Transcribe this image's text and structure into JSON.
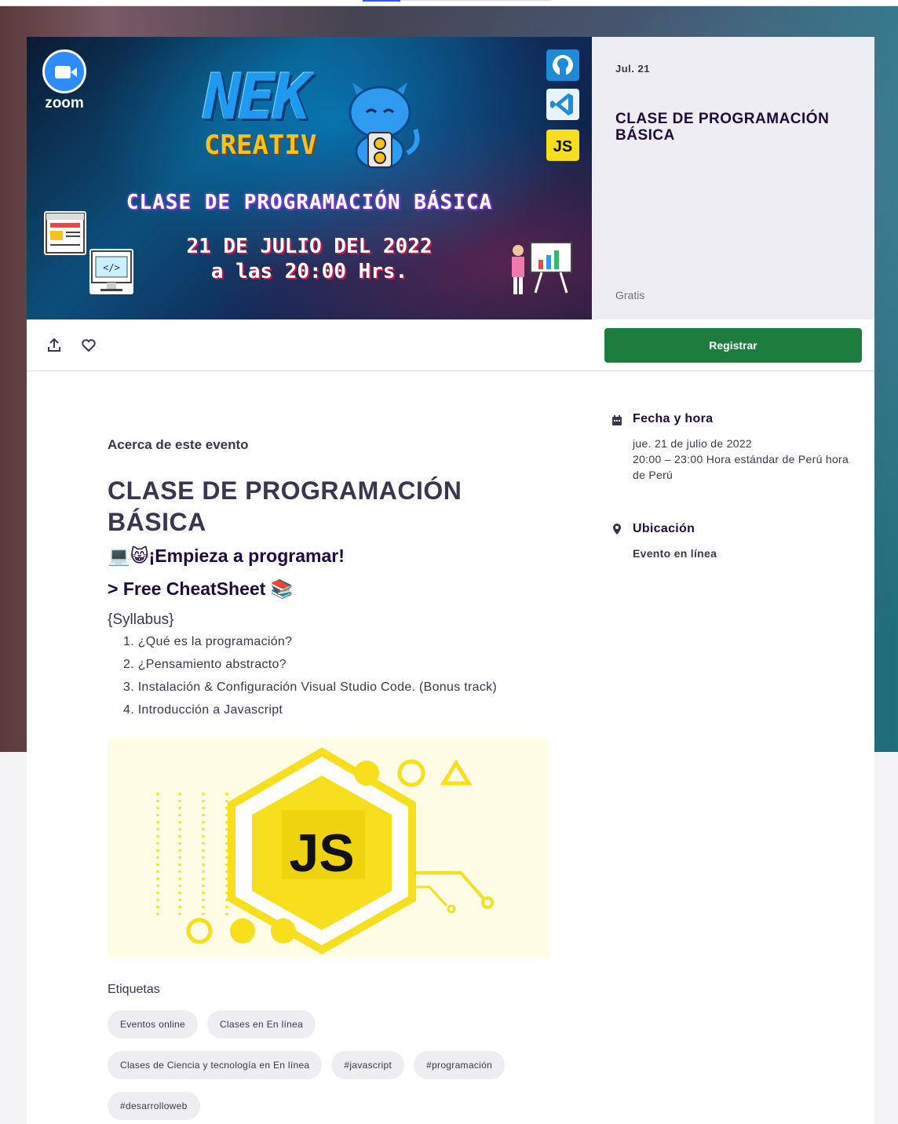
{
  "hero": {
    "app": "zoom",
    "brand_line1": "NEK",
    "brand_line2": "CREATIV",
    "title": "CLASE DE PROGRAMACIÓN BÁSICA",
    "date_line1": "21 DE JULIO DEL 2022",
    "date_line2": "a las 20:00 Hrs.",
    "js_badge": "JS"
  },
  "side": {
    "date": "Jul. 21",
    "title": "CLASE DE PROGRAMACIÓN BÁSICA",
    "price": "Gratis"
  },
  "actions": {
    "register_label": "Registrar"
  },
  "event": {
    "about_label": "Acerca de este evento",
    "title": "CLASE DE PROGRAMACIÓN BÁSICA",
    "tagline1": "💻😸¡Empieza a programar!",
    "tagline2": "> Free CheatSheet 📚",
    "syllabus_label": "{Syllabus}",
    "syllabus": [
      "1. ¿Qué es la programación?",
      "2. ¿Pensamiento abstracto?",
      "3. Instalación & Configuración Visual Studio Code. (Bonus track)",
      "4. Introducción a Javascript"
    ],
    "banner_text": "JS",
    "tags_label": "Etiquetas",
    "tags": [
      "Eventos online",
      "Clases en En línea",
      "Clases de Ciencia y tecnología en En línea",
      "#javascript",
      "#programación",
      "#desarrolloweb"
    ]
  },
  "details": {
    "date_heading": "Fecha y hora",
    "date_line1": "jue. 21 de julio de 2022",
    "date_line2": "20:00 – 23:00 Hora estándar de Perú hora de Perú",
    "location_heading": "Ubicación",
    "location_text": "Evento en línea"
  },
  "colors": {
    "register": "#1c7d3f",
    "title": "#1e0a3c",
    "text": "#39364f",
    "js_yellow": "#f7df1e"
  }
}
